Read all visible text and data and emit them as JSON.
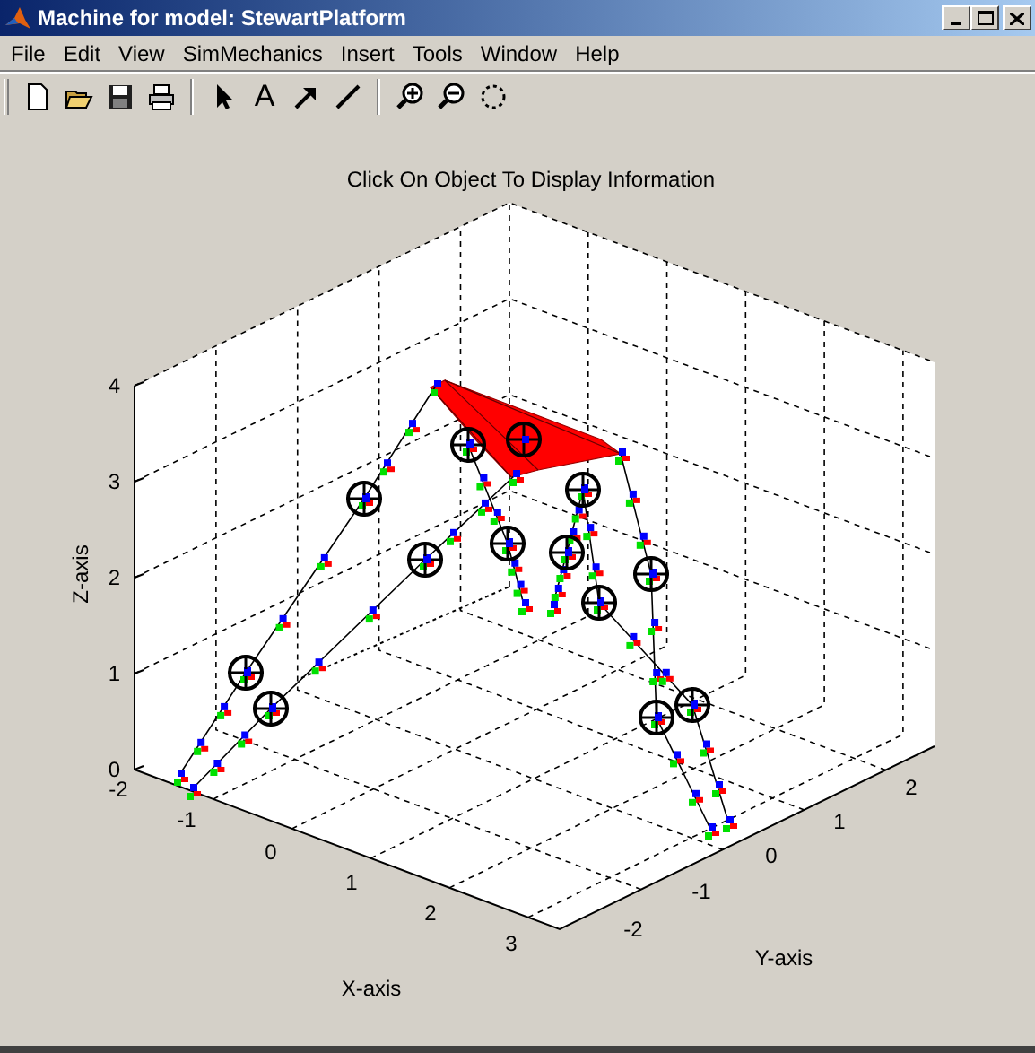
{
  "window": {
    "title": "Machine for model: StewartPlatform"
  },
  "menus": [
    "File",
    "Edit",
    "View",
    "SimMechanics",
    "Insert",
    "Tools",
    "Window",
    "Help"
  ],
  "toolbar": [
    {
      "kind": "new"
    },
    {
      "kind": "open"
    },
    {
      "kind": "save"
    },
    {
      "kind": "print"
    },
    {
      "kind": "separator"
    },
    {
      "kind": "pointer"
    },
    {
      "kind": "text",
      "glyph": "A"
    },
    {
      "kind": "arrow"
    },
    {
      "kind": "line"
    },
    {
      "kind": "separator"
    },
    {
      "kind": "zoom_in"
    },
    {
      "kind": "zoom_out"
    },
    {
      "kind": "rotate"
    }
  ],
  "plot": {
    "title": "Click On Object To Display Information",
    "xlabel": "X-axis",
    "ylabel": "Y-axis",
    "zlabel": "Z-axis",
    "zticks": [
      "4",
      "3",
      "2",
      "1",
      "0"
    ],
    "xticks": [
      "-2",
      "-1",
      "0",
      "1",
      "2",
      "3"
    ],
    "yticks": [
      "-2",
      "-1",
      "0",
      "1",
      "2"
    ]
  }
}
